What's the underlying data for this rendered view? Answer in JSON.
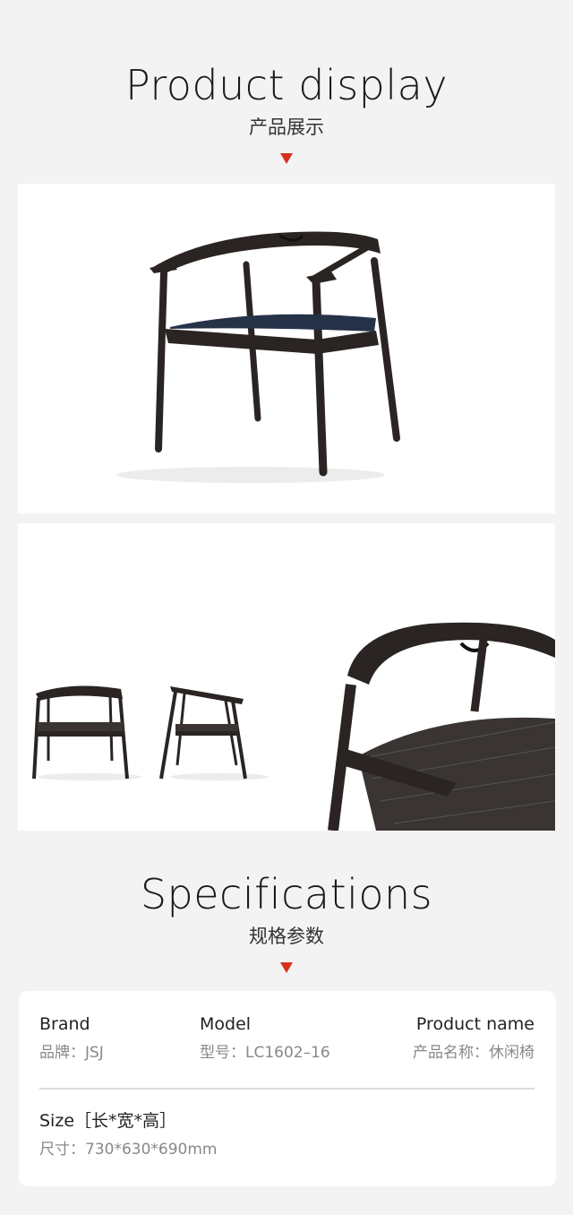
{
  "display_section": {
    "title_en": "Product display",
    "title_cn": "产品展示"
  },
  "spec_section": {
    "title_en": "Specifications",
    "title_cn": "规格参数"
  },
  "specs": {
    "brand_label": "Brand",
    "brand_value": "品牌：JSJ",
    "model_label": "Model",
    "model_value": "型号：LC1602–16",
    "product_name_label": "Product name",
    "product_name_value": "产品名称：休闲椅",
    "size_label": "Size［长*宽*高］",
    "size_value": "尺寸：730*630*690mm"
  },
  "colors": {
    "accent": "#d7301f",
    "background": "#f3f3f3",
    "card": "#ffffff",
    "wood": "#2a2422",
    "seat": "#263247"
  }
}
